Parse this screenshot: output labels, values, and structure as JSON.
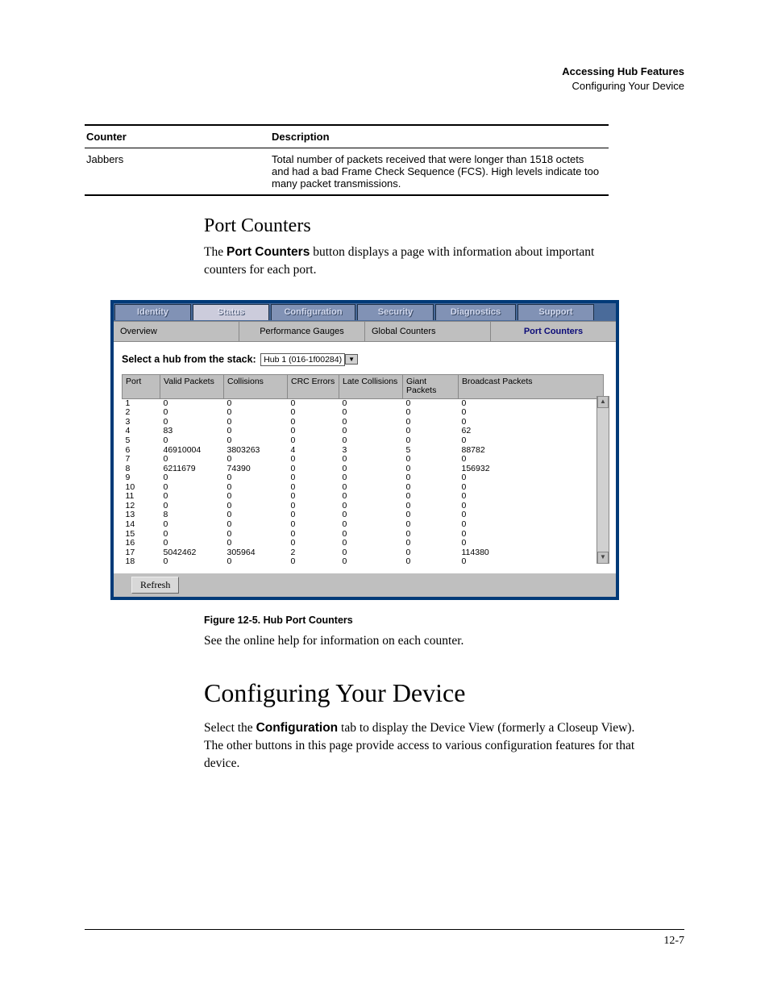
{
  "header": {
    "title": "Accessing Hub Features",
    "subtitle": "Configuring Your Device"
  },
  "counter_table": {
    "head_counter": "Counter",
    "head_description": "Description",
    "row_counter": "Jabbers",
    "row_description": "Total number of packets received that were longer than 1518 octets and had a bad Frame Check Sequence (FCS). High levels indicate too many packet transmissions."
  },
  "section_pc": {
    "heading": "Port Counters",
    "para_before": "The ",
    "para_bold": "Port Counters",
    "para_after": " button displays a page with information about important counters for each port."
  },
  "ui": {
    "tabs": {
      "identity": "Identity",
      "status": "Status",
      "configuration": "Configuration",
      "security": "Security",
      "diagnostics": "Diagnostics",
      "support": "Support"
    },
    "subtabs": {
      "overview": "Overview",
      "perf": "Performance Gauges",
      "global": "Global Counters",
      "port": "Port Counters"
    },
    "select_label": "Select a hub from the stack:",
    "select_value": "Hub 1 (016-1f00284)",
    "columns": {
      "port": "Port",
      "valid": "Valid Packets",
      "coll": "Collisions",
      "crc": "CRC Errors",
      "late": "Late Collisions",
      "giant": "Giant Packets",
      "bcast": "Broadcast Packets"
    },
    "refresh": "Refresh"
  },
  "chart_data": {
    "type": "table",
    "title": "Hub Port Counters",
    "columns": [
      "Port",
      "Valid Packets",
      "Collisions",
      "CRC Errors",
      "Late Collisions",
      "Giant Packets",
      "Broadcast Packets"
    ],
    "rows": [
      {
        "port": "1",
        "valid": "0",
        "coll": "0",
        "crc": "0",
        "late": "0",
        "giant": "0",
        "bcast": "0"
      },
      {
        "port": "2",
        "valid": "0",
        "coll": "0",
        "crc": "0",
        "late": "0",
        "giant": "0",
        "bcast": "0"
      },
      {
        "port": "3",
        "valid": "0",
        "coll": "0",
        "crc": "0",
        "late": "0",
        "giant": "0",
        "bcast": "0"
      },
      {
        "port": "4",
        "valid": "83",
        "coll": "0",
        "crc": "0",
        "late": "0",
        "giant": "0",
        "bcast": "62"
      },
      {
        "port": "5",
        "valid": "0",
        "coll": "0",
        "crc": "0",
        "late": "0",
        "giant": "0",
        "bcast": "0"
      },
      {
        "port": "6",
        "valid": "46910004",
        "coll": "3803263",
        "crc": "4",
        "late": "3",
        "giant": "5",
        "bcast": "88782"
      },
      {
        "port": "7",
        "valid": "0",
        "coll": "0",
        "crc": "0",
        "late": "0",
        "giant": "0",
        "bcast": "0"
      },
      {
        "port": "8",
        "valid": "6211679",
        "coll": "74390",
        "crc": "0",
        "late": "0",
        "giant": "0",
        "bcast": "156932"
      },
      {
        "port": "9",
        "valid": "0",
        "coll": "0",
        "crc": "0",
        "late": "0",
        "giant": "0",
        "bcast": "0"
      },
      {
        "port": "10",
        "valid": "0",
        "coll": "0",
        "crc": "0",
        "late": "0",
        "giant": "0",
        "bcast": "0"
      },
      {
        "port": "11",
        "valid": "0",
        "coll": "0",
        "crc": "0",
        "late": "0",
        "giant": "0",
        "bcast": "0"
      },
      {
        "port": "12",
        "valid": "0",
        "coll": "0",
        "crc": "0",
        "late": "0",
        "giant": "0",
        "bcast": "0"
      },
      {
        "port": "13",
        "valid": "8",
        "coll": "0",
        "crc": "0",
        "late": "0",
        "giant": "0",
        "bcast": "0"
      },
      {
        "port": "14",
        "valid": "0",
        "coll": "0",
        "crc": "0",
        "late": "0",
        "giant": "0",
        "bcast": "0"
      },
      {
        "port": "15",
        "valid": "0",
        "coll": "0",
        "crc": "0",
        "late": "0",
        "giant": "0",
        "bcast": "0"
      },
      {
        "port": "16",
        "valid": "0",
        "coll": "0",
        "crc": "0",
        "late": "0",
        "giant": "0",
        "bcast": "0"
      },
      {
        "port": "17",
        "valid": "5042462",
        "coll": "305964",
        "crc": "2",
        "late": "0",
        "giant": "0",
        "bcast": "114380"
      },
      {
        "port": "18",
        "valid": "0",
        "coll": "0",
        "crc": "0",
        "late": "0",
        "giant": "0",
        "bcast": "0"
      }
    ]
  },
  "fig_caption": "Figure 12-5. Hub Port Counters",
  "after_ui_para": "See the online help for information on each counter.",
  "section_cfg": {
    "heading": "Configuring Your Device",
    "p_before": "Select the ",
    "p_bold": "Configuration",
    "p_after": " tab to display the Device View (formerly a Closeup View). The other buttons in this page provide access to various configuration features for that device."
  },
  "page_number": "12-7"
}
